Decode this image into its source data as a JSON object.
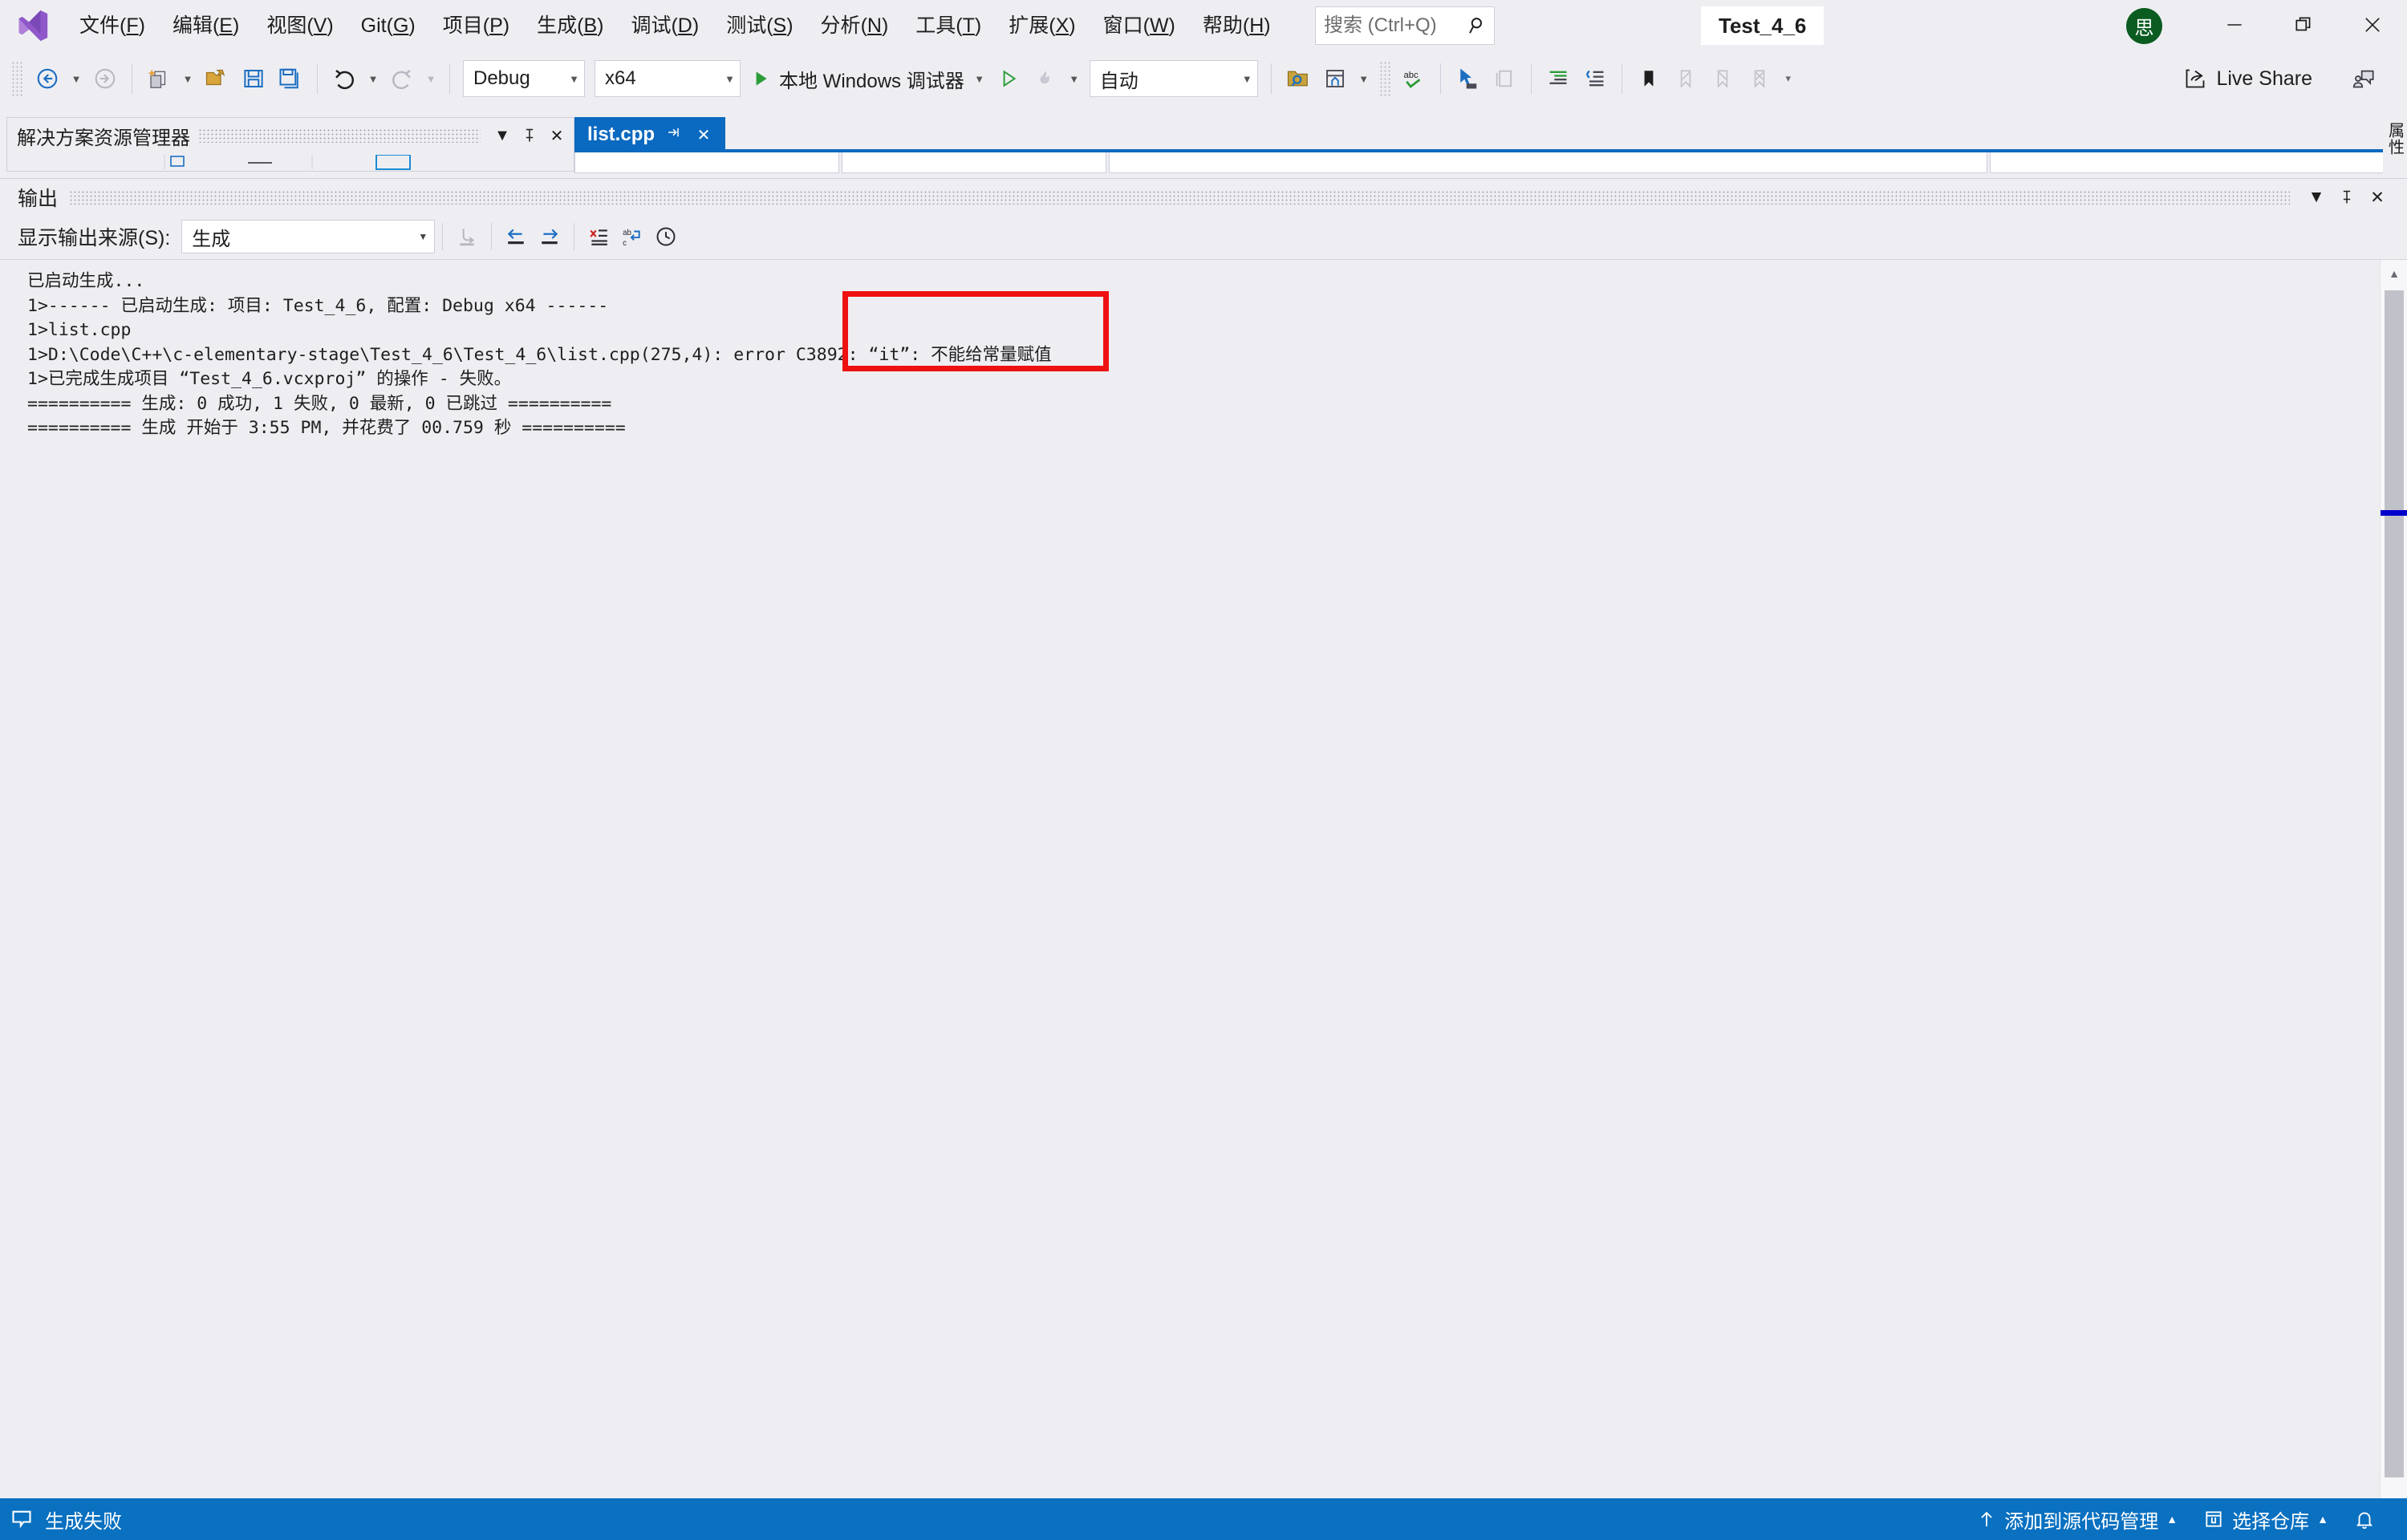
{
  "window": {
    "title": "Test_4_6",
    "avatar_initial": "思",
    "minimize": "—",
    "maximize": "❐",
    "close": "✕"
  },
  "menubar": {
    "logo": "visual-studio-logo",
    "items": [
      {
        "label": "文件",
        "mnemonic": "F"
      },
      {
        "label": "编辑",
        "mnemonic": "E"
      },
      {
        "label": "视图",
        "mnemonic": "V"
      },
      {
        "label": "Git",
        "mnemonic": "G"
      },
      {
        "label": "项目",
        "mnemonic": "P"
      },
      {
        "label": "生成",
        "mnemonic": "B"
      },
      {
        "label": "调试",
        "mnemonic": "D"
      },
      {
        "label": "测试",
        "mnemonic": "S"
      },
      {
        "label": "分析",
        "mnemonic": "N"
      },
      {
        "label": "工具",
        "mnemonic": "T"
      },
      {
        "label": "扩展",
        "mnemonic": "X"
      },
      {
        "label": "窗口",
        "mnemonic": "W"
      },
      {
        "label": "帮助",
        "mnemonic": "H"
      }
    ]
  },
  "search": {
    "placeholder": "搜索 (Ctrl+Q)",
    "value": "",
    "icon": "search-icon"
  },
  "toolbar": {
    "configuration": "Debug",
    "platform": "x64",
    "run_label": "本地 Windows 调试器",
    "auto_select": "自动",
    "live_share": "Live Share",
    "caret": "▼"
  },
  "solution_explorer": {
    "title": "解决方案资源管理器",
    "dropdown_icon": "▼",
    "pin_icon": "pin-icon",
    "close_icon": "✕"
  },
  "document_tab": {
    "label": "list.cpp",
    "pin_icon": "⇥",
    "close_icon": "✕"
  },
  "right_dock": {
    "label": "属性"
  },
  "output": {
    "title": "输出",
    "source_label": "显示输出来源(S):",
    "source_value": "生成",
    "source_caret": "▼",
    "dropdown_icon": "▼",
    "pin_icon": "pin-icon",
    "close_icon": "✕",
    "toolbar_buttons": [
      "go-to-message-icon",
      "previous-message-icon",
      "next-message-icon",
      "clear-all-icon",
      "toggle-word-wrap-icon",
      "toggle-timestamps-icon"
    ],
    "lines": [
      "已启动生成...",
      "1>------ 已启动生成: 项目: Test_4_6, 配置: Debug x64 ------",
      "1>list.cpp",
      "1>D:\\Code\\C++\\c-elementary-stage\\Test_4_6\\Test_4_6\\list.cpp(275,4): error C3892: “it”: 不能给常量赋值",
      "1>已完成生成项目 “Test_4_6.vcxproj” 的操作 - 失败。",
      "========== 生成: 0 成功, 1 失败, 0 最新, 0 已跳过 ==========",
      "========== 生成 开始于 3:55 PM, 并花费了 00.759 秒 =========="
    ],
    "annotation": {
      "color": "#ee1111",
      "highlights_text": "“it”: 不能给常量赋值"
    },
    "scrollbar": {
      "up_arrow": "▲",
      "mark_color": "#0000cc"
    }
  },
  "statusbar": {
    "build_status": "生成失败",
    "source_control": "添加到源代码管理",
    "repository": "选择仓库",
    "caret_up": "▲",
    "notification_icon": "bell-icon",
    "background": "#0a70c0"
  }
}
